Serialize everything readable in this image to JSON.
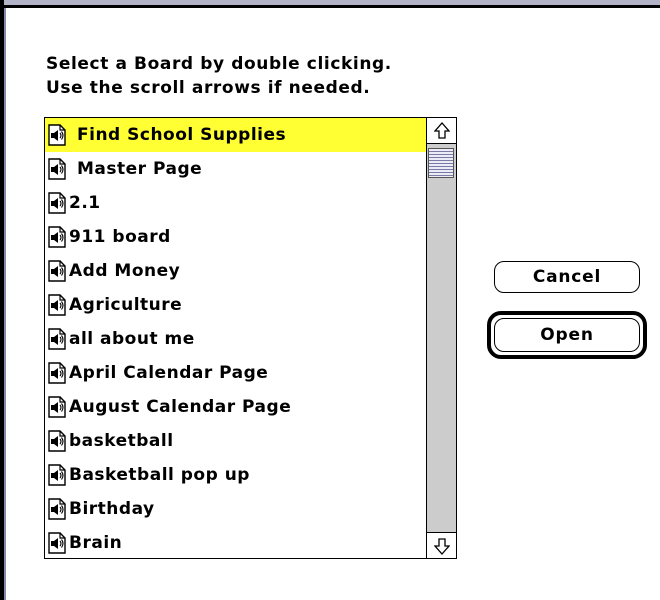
{
  "dialog": {
    "instructions": [
      "Select a Board by double clicking.",
      "Use the scroll arrows if needed."
    ],
    "selected_index": 0,
    "highlight_color": "#ffff33",
    "items": [
      {
        "label": "Find School Supplies",
        "indent": true
      },
      {
        "label": "Master Page",
        "indent": true
      },
      {
        "label": "2.1",
        "indent": false
      },
      {
        "label": "911 board",
        "indent": false
      },
      {
        "label": "Add Money",
        "indent": false
      },
      {
        "label": "Agriculture",
        "indent": false
      },
      {
        "label": "all about me",
        "indent": false
      },
      {
        "label": "April Calendar Page",
        "indent": false
      },
      {
        "label": "August Calendar Page",
        "indent": false
      },
      {
        "label": "basketball",
        "indent": false
      },
      {
        "label": "Basketball pop up",
        "indent": false
      },
      {
        "label": "Birthday",
        "indent": false
      },
      {
        "label": "Brain",
        "indent": false
      }
    ],
    "item_icon": "speaker-document-icon",
    "buttons": {
      "cancel_label": "Cancel",
      "open_label": "Open",
      "default": "open"
    },
    "scrollbar": {
      "up_icon": "scroll-up-arrow-icon",
      "down_icon": "scroll-down-arrow-icon"
    }
  }
}
